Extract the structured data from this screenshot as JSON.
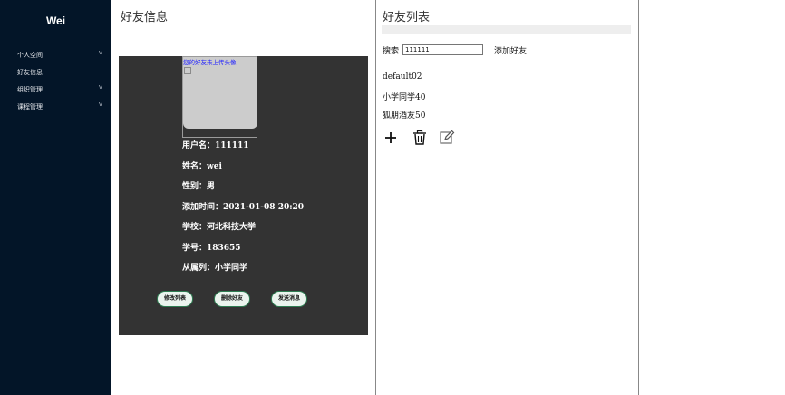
{
  "sidebar": {
    "brand": "Wei",
    "items": [
      {
        "label": "个人空间",
        "chevron": "v"
      },
      {
        "label": "好友信息",
        "chevron": ""
      },
      {
        "label": "组织管理",
        "chevron": "v"
      },
      {
        "label": "课程管理",
        "chevron": "v"
      }
    ]
  },
  "friend_info": {
    "title": "好友信息",
    "avatar_caption": "您的好友未上传头像",
    "fields": [
      "用户名：111111",
      "姓名：wei",
      "性别：男",
      "添加时间：2021-01-08 20:20",
      "学校：河北科技大学",
      "学号：183655",
      "从属列：小学同学"
    ],
    "buttons": [
      "修改列表",
      "删除好友",
      "发送消息"
    ]
  },
  "friend_list": {
    "title": "好友列表",
    "search_label": "搜索",
    "search_value": "111111",
    "add_label": "添加好友",
    "groups": [
      "default02",
      "小学同学40",
      "狐朋酒友50"
    ],
    "icons": [
      "plus-icon",
      "trash-icon",
      "edit-icon"
    ]
  }
}
